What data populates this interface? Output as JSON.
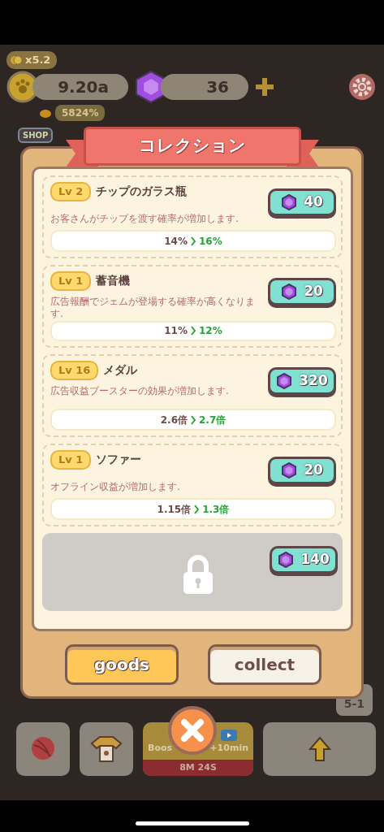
{
  "hud": {
    "multiplier": "x5.2",
    "coins": "9.20a",
    "bonus": "5824%",
    "gems": "36",
    "shop_label": "SHOP"
  },
  "dialog": {
    "title": "コレクション",
    "items": [
      {
        "kind": "item",
        "level": "Lv 2",
        "name": "チップのガラス瓶",
        "description": "お客さんがチップを渡す確率が増加します.",
        "price": "40",
        "current": "14%",
        "next": "16%"
      },
      {
        "kind": "item",
        "level": "Lv 1",
        "name": "蓄音機",
        "description": "広告報酬でジェムが登場する確率が高くなります.",
        "price": "20",
        "current": "11%",
        "next": "12%"
      },
      {
        "kind": "item",
        "level": "Lv 16",
        "name": "メダル",
        "description": "広告収益ブースターの効果が増加します.",
        "price": "320",
        "current": "2.6倍",
        "next": "2.7倍"
      },
      {
        "kind": "item",
        "level": "Lv 1",
        "name": "ソファー",
        "description": "オフライン収益が増加します.",
        "price": "20",
        "current": "1.15倍",
        "next": "1.3倍"
      },
      {
        "kind": "locked",
        "price": "140"
      }
    ],
    "tabs": [
      {
        "label": "goods",
        "selected": true
      },
      {
        "label": "collect",
        "selected": false
      }
    ]
  },
  "toolbar": {
    "stage": "5-1",
    "boost_label": "Boos",
    "boost_bonus": "+10min",
    "boost_timer": "8M 24S"
  }
}
